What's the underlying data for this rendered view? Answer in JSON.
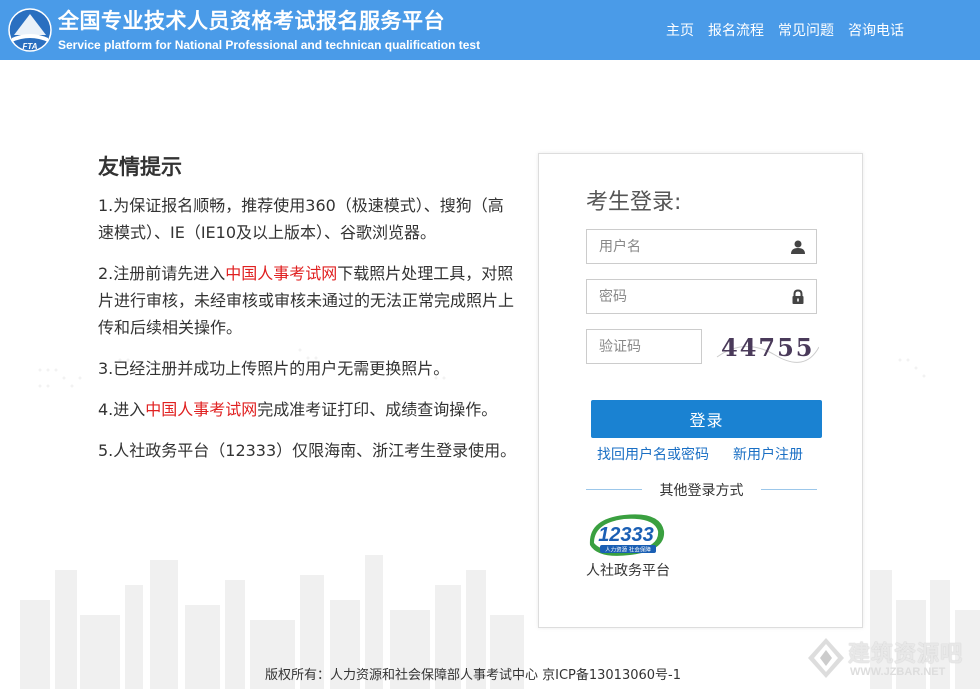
{
  "header": {
    "logo_text": "FTA",
    "title_cn": "全国专业技术人员资格考试报名服务平台",
    "title_en": "Service platform for National Professional and technican qualification test",
    "nav": [
      "主页",
      "报名流程",
      "常见问题",
      "咨询电话"
    ]
  },
  "tips": {
    "heading": "友情提示",
    "items": [
      {
        "pre": "1.为保证报名顺畅，推荐使用360（极速模式）、搜狗（高速模式）、IE（IE10及以上版本）、谷歌浏览器。",
        "link": "",
        "post": ""
      },
      {
        "pre": "2.注册前请先进入",
        "link": "中国人事考试网",
        "post": "下载照片处理工具，对照片进行审核，未经审核或审核未通过的无法正常完成照片上传和后续相关操作。"
      },
      {
        "pre": "3.已经注册并成功上传照片的用户无需更换照片。",
        "link": "",
        "post": ""
      },
      {
        "pre": "4.进入",
        "link": "中国人事考试网",
        "post": "完成准考证打印、成绩查询操作。"
      },
      {
        "pre": "5.人社政务平台（12333）仅限海南、浙江考生登录使用。",
        "link": "",
        "post": ""
      }
    ]
  },
  "login": {
    "title": "考生登录:",
    "username_placeholder": "用户名",
    "password_placeholder": "密码",
    "captcha_placeholder": "验证码",
    "captcha_text": "44755",
    "submit_label": "登录",
    "forgot_link": "找回用户名或密码",
    "register_link": "新用户注册",
    "other_methods": "其他登录方式",
    "badge_number": "12333",
    "badge_sub": "人力资源 社会保障",
    "badge_label": "人社政务平台"
  },
  "footer": {
    "copyright": "版权所有：人力资源和社会保障部人事考试中心 京ICP备13013060号-1"
  },
  "watermark": {
    "cn": "建筑资源吧",
    "en": "WWW.JZBAR.NET"
  },
  "colors": {
    "header_bg": "#4a9be8",
    "button_bg": "#1a82d2",
    "link": "#1a6fc4",
    "highlight_red": "#e02020"
  },
  "icons": {
    "username": "user-icon",
    "password": "lock-icon"
  }
}
